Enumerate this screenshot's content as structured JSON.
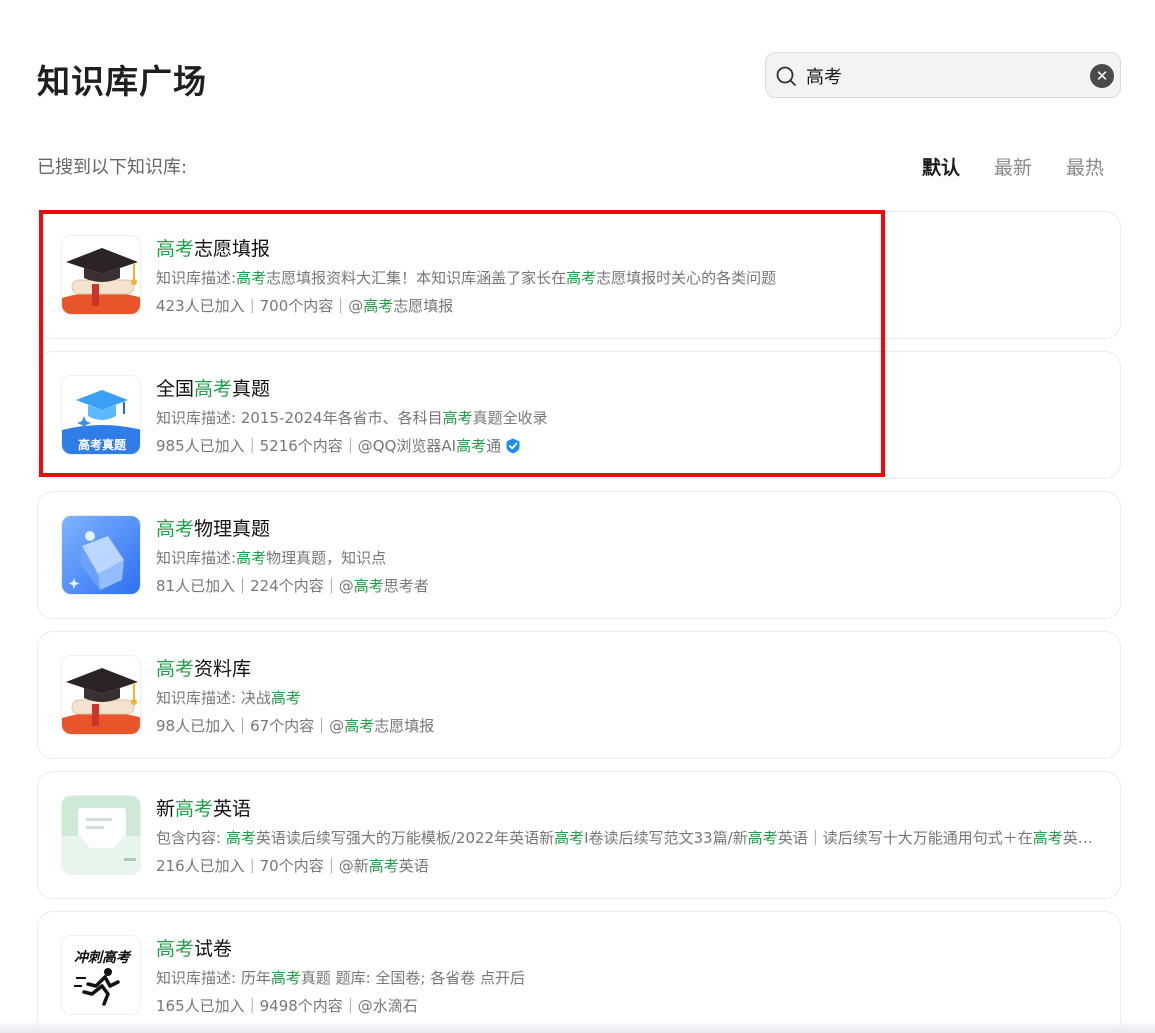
{
  "page": {
    "title": "知识库广场"
  },
  "search": {
    "value": "高考"
  },
  "results": {
    "label": "已搜到以下知识库:"
  },
  "sort": {
    "tabs": [
      "默认",
      "最新",
      "最热"
    ],
    "active": "默认"
  },
  "colors": {
    "highlight": "#1e9f45",
    "frame": "#ee0a0a",
    "verified": "#1f8cf0"
  },
  "cards": [
    {
      "thumb": "graduation-cap-diploma-icon",
      "title": [
        {
          "t": "高考",
          "hl": true
        },
        {
          "t": "志愿填报",
          "hl": false
        }
      ],
      "desc": [
        {
          "t": "知识库描述:",
          "hl": false
        },
        {
          "t": "高考",
          "hl": true
        },
        {
          "t": "志愿填报资料大汇集！本知识库涵盖了家长在",
          "hl": false
        },
        {
          "t": "高考",
          "hl": true
        },
        {
          "t": "志愿填报时关心的各类问题",
          "hl": false
        }
      ],
      "meta": [
        {
          "t": "423人已加入｜700个内容｜@",
          "hl": false
        },
        {
          "t": "高考",
          "hl": true
        },
        {
          "t": "志愿填报",
          "hl": false
        }
      ],
      "verified": false
    },
    {
      "thumb": "blue-cap-exam-icon",
      "thumb_text": "高考真题",
      "title": [
        {
          "t": "全国",
          "hl": false
        },
        {
          "t": "高考",
          "hl": true
        },
        {
          "t": "真题",
          "hl": false
        }
      ],
      "desc": [
        {
          "t": "知识库描述: 2015-2024年各省市、各科目",
          "hl": false
        },
        {
          "t": "高考",
          "hl": true
        },
        {
          "t": "真题全收录",
          "hl": false
        }
      ],
      "meta": [
        {
          "t": "985人已加入｜5216个内容｜@QQ浏览器AI",
          "hl": false
        },
        {
          "t": "高考",
          "hl": true
        },
        {
          "t": "通",
          "hl": false
        }
      ],
      "verified": true
    },
    {
      "thumb": "abstract-cube-icon",
      "title": [
        {
          "t": "高考",
          "hl": true
        },
        {
          "t": "物理真题",
          "hl": false
        }
      ],
      "desc": [
        {
          "t": "知识库描述:",
          "hl": false
        },
        {
          "t": "高考",
          "hl": true
        },
        {
          "t": "物理真题，知识点",
          "hl": false
        }
      ],
      "meta": [
        {
          "t": "81人已加入｜224个内容｜@",
          "hl": false
        },
        {
          "t": "高考",
          "hl": true
        },
        {
          "t": "思考者",
          "hl": false
        }
      ],
      "verified": false
    },
    {
      "thumb": "graduation-cap-diploma-icon",
      "title": [
        {
          "t": "高考",
          "hl": true
        },
        {
          "t": "资料库",
          "hl": false
        }
      ],
      "desc": [
        {
          "t": "知识库描述: 决战",
          "hl": false
        },
        {
          "t": "高考",
          "hl": true
        }
      ],
      "meta": [
        {
          "t": "98人已加入｜67个内容｜@",
          "hl": false
        },
        {
          "t": "高考",
          "hl": true
        },
        {
          "t": "志愿填报",
          "hl": false
        }
      ],
      "verified": false
    },
    {
      "thumb": "green-document-folder-icon",
      "title": [
        {
          "t": "新",
          "hl": false
        },
        {
          "t": "高考",
          "hl": true
        },
        {
          "t": "英语",
          "hl": false
        }
      ],
      "desc": [
        {
          "t": "包含内容: ",
          "hl": false
        },
        {
          "t": "高考",
          "hl": true
        },
        {
          "t": "英语读后续写强大的万能模板/2022年英语新",
          "hl": false
        },
        {
          "t": "高考",
          "hl": true
        },
        {
          "t": "I卷读后续写范文33篇/新",
          "hl": false
        },
        {
          "t": "高考",
          "hl": true
        },
        {
          "t": "英语｜读后续写十大万能通用句式＋在",
          "hl": false
        },
        {
          "t": "高考",
          "hl": true
        },
        {
          "t": "英语中的应用",
          "hl": false
        }
      ],
      "meta": [
        {
          "t": "216人已加入｜70个内容｜@新",
          "hl": false
        },
        {
          "t": "高考",
          "hl": true
        },
        {
          "t": "英语",
          "hl": false
        }
      ],
      "verified": false
    },
    {
      "thumb": "sprint-runner-icon",
      "thumb_text": "冲刺高考",
      "title": [
        {
          "t": "高考",
          "hl": true
        },
        {
          "t": "试卷",
          "hl": false
        }
      ],
      "desc": [
        {
          "t": "知识库描述: 历年",
          "hl": false
        },
        {
          "t": "高考",
          "hl": true
        },
        {
          "t": "真题 题库: 全国卷; 各省卷 点开后",
          "hl": false
        }
      ],
      "meta": [
        {
          "t": "165人已加入｜9498个内容｜@水滴石",
          "hl": false
        }
      ],
      "verified": false
    }
  ]
}
